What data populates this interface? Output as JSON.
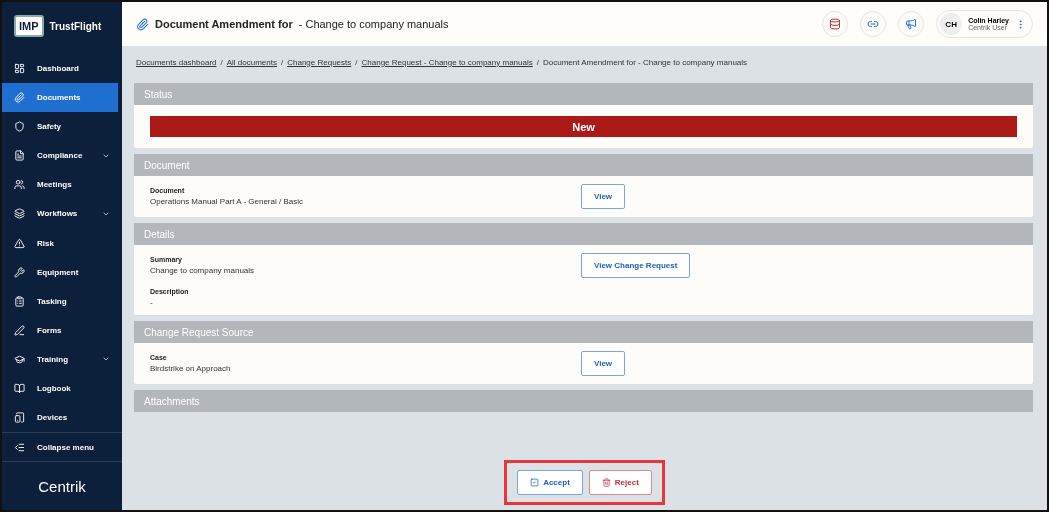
{
  "sidebar": {
    "logo_badge": "IMP",
    "brand": "TrustFlight",
    "items": [
      {
        "label": "Dashboard",
        "selected": false,
        "expandable": false
      },
      {
        "label": "Documents",
        "selected": true,
        "expandable": false
      },
      {
        "label": "Safety",
        "selected": false,
        "expandable": false
      },
      {
        "label": "Compliance",
        "selected": false,
        "expandable": true
      },
      {
        "label": "Meetings",
        "selected": false,
        "expandable": false
      },
      {
        "label": "Workflows",
        "selected": false,
        "expandable": true
      },
      {
        "label": "Risk",
        "selected": false,
        "expandable": false
      },
      {
        "label": "Equipment",
        "selected": false,
        "expandable": false
      },
      {
        "label": "Tasking",
        "selected": false,
        "expandable": false
      },
      {
        "label": "Forms",
        "selected": false,
        "expandable": false
      },
      {
        "label": "Training",
        "selected": false,
        "expandable": true
      },
      {
        "label": "Logbook",
        "selected": false,
        "expandable": false
      },
      {
        "label": "Devices",
        "selected": false,
        "expandable": false
      }
    ],
    "collapse": "Collapse menu",
    "footer_logo": "Centrik"
  },
  "header": {
    "title": "Document Amendment for",
    "subtitle": "- Change to company manuals",
    "user": {
      "initials": "CH",
      "name": "Colin Harley",
      "role": "Centrik User"
    }
  },
  "breadcrumbs": [
    {
      "label": "Documents dashboard",
      "link": true
    },
    {
      "separator": "/",
      "label": "All documents",
      "link": true
    },
    {
      "separator": "/",
      "label": "Change Requests",
      "link": true
    },
    {
      "separator": "/",
      "label": "Change Request - Change to company manuals",
      "link": true
    },
    {
      "separator": "/",
      "label": "Document Amendment for - Change to company manuals",
      "link": false
    }
  ],
  "sections": [
    {
      "title": "Status",
      "kind": "status",
      "status": "New",
      "color": "#ac1a17"
    },
    {
      "title": "Document",
      "kind": "fields",
      "fields": [
        {
          "label": "Document",
          "value": "Operations Manual Part A - General / Basic",
          "button": "View"
        }
      ]
    },
    {
      "title": "Details",
      "kind": "fields",
      "fields": [
        {
          "label": "Summary",
          "value": "Change to company manuals",
          "button": "View Change Request"
        },
        {
          "label": "Description",
          "value": "-"
        }
      ]
    },
    {
      "title": "Change Request Source",
      "kind": "fields",
      "fields": [
        {
          "label": "Case",
          "value": "Birdstrike on Approach",
          "button": "View"
        }
      ]
    },
    {
      "title": "Attachments",
      "kind": "header"
    }
  ],
  "actions": [
    {
      "label": "Accept",
      "kind": "accept"
    },
    {
      "label": "Reject",
      "kind": "reject"
    }
  ]
}
